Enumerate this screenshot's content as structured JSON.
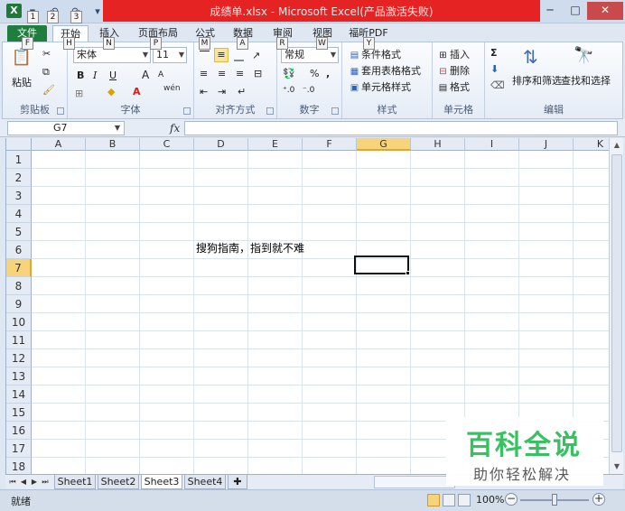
{
  "title_bar": {
    "title": "成绩单.xlsx - Microsoft Excel(产品激活失败)",
    "app_icon": "X",
    "keytips": [
      "1",
      "2",
      "3"
    ]
  },
  "tabs": [
    {
      "label": "文件",
      "keytip": "F"
    },
    {
      "label": "开始",
      "keytip": "H"
    },
    {
      "label": "插入",
      "keytip": "N"
    },
    {
      "label": "页面布局",
      "keytip": "P"
    },
    {
      "label": "公式",
      "keytip": "M"
    },
    {
      "label": "数据",
      "keytip": "A"
    },
    {
      "label": "审阅",
      "keytip": "R"
    },
    {
      "label": "视图",
      "keytip": "W"
    },
    {
      "label": "福昕PDF",
      "keytip": "Y"
    }
  ],
  "ribbon": {
    "clipboard": {
      "paste": "粘贴",
      "label": "剪贴板"
    },
    "font": {
      "name": "宋体",
      "size": "11",
      "label": "字体",
      "bold": "B",
      "italic": "I",
      "underline": "U",
      "grow": "A",
      "shrink": "A",
      "phonetic": "wén"
    },
    "alignment": {
      "label": "对齐方式"
    },
    "number": {
      "format": "常规",
      "label": "数字",
      "percent": "%",
      "comma": ","
    },
    "styles": {
      "conditional": "条件格式",
      "table": "套用表格格式",
      "cell": "单元格样式",
      "label": "样式"
    },
    "cells": {
      "insert": "插入",
      "delete": "删除",
      "format": "格式",
      "label": "单元格"
    },
    "editing": {
      "sigma": "Σ",
      "sort": "排序和筛选",
      "find": "查找和选择",
      "label": "编辑"
    }
  },
  "formula_bar": {
    "name_box": "G7",
    "fx": "fx",
    "value": ""
  },
  "grid": {
    "columns": [
      "A",
      "B",
      "C",
      "D",
      "E",
      "F",
      "G",
      "H",
      "I",
      "J",
      "K"
    ],
    "rows": [
      "1",
      "2",
      "3",
      "4",
      "5",
      "6",
      "7",
      "8",
      "9",
      "10",
      "11",
      "12",
      "13",
      "14",
      "15",
      "16",
      "17",
      "18"
    ],
    "selected_col": "G",
    "selected_row": "7",
    "cell_d6": "搜狗指南，指到就不难"
  },
  "sheets": [
    "Sheet1",
    "Sheet2",
    "Sheet3",
    "Sheet4"
  ],
  "active_sheet": "Sheet3",
  "status": {
    "ready": "就绪",
    "zoom": "100%"
  },
  "watermark": {
    "title": "百科全说",
    "subtitle": "助你轻松解决"
  }
}
